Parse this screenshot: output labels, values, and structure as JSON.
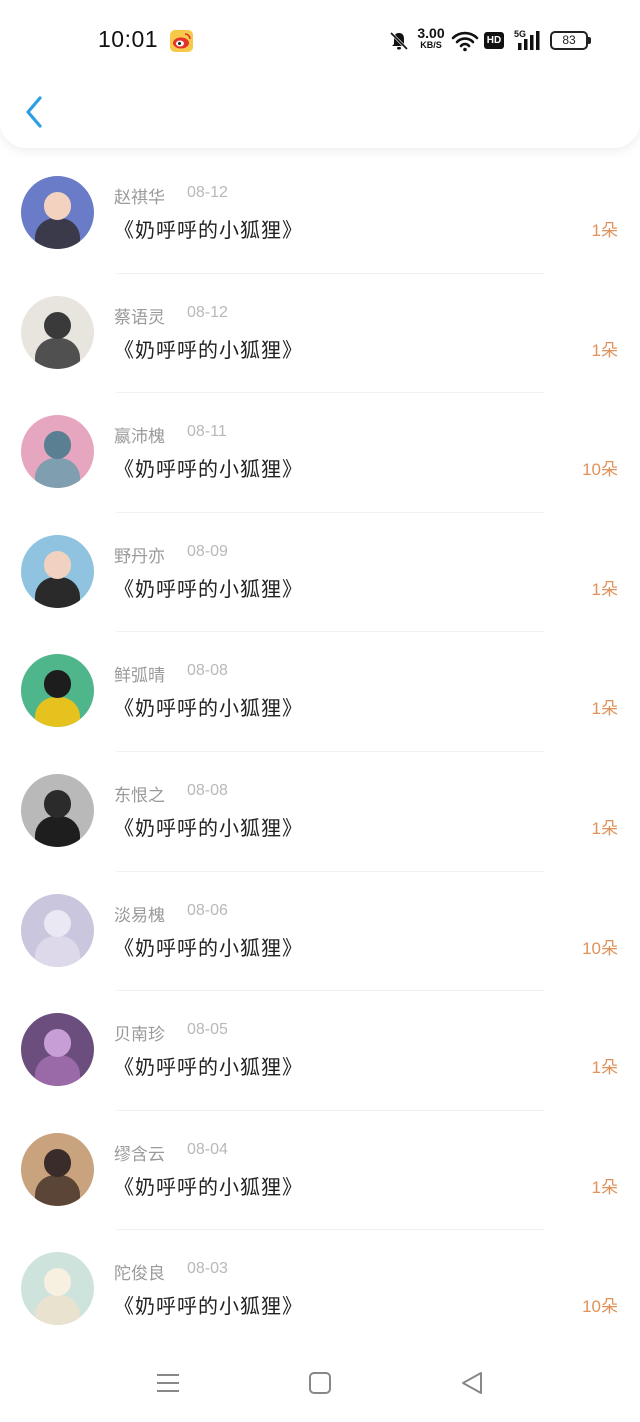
{
  "status_bar": {
    "time": "10:01",
    "net_speed_value": "3.00",
    "net_speed_unit": "KB/S",
    "hd_label": "HD",
    "cellular_label": "5G",
    "battery_level": "83",
    "icons": [
      "weibo-icon",
      "mute-bell-icon",
      "wifi-icon",
      "hd-icon",
      "signal-icon",
      "battery-icon"
    ]
  },
  "header": {
    "back_icon": "chevron-left-icon"
  },
  "colors": {
    "accent_blue": "#2b9fe6",
    "count_orange": "#e0925a",
    "name_gray": "#9a9a9a",
    "date_gray": "#b8b8b8"
  },
  "records": [
    {
      "name": "赵祺华",
      "date": "08-12",
      "gift": "《奶呼呼的小狐狸》",
      "count": "1朵",
      "avatar_bg": "#6a7cc7",
      "avatar_fg": "#f3d3bf",
      "avatar_body": "#3a3a4a"
    },
    {
      "name": "蔡语灵",
      "date": "08-12",
      "gift": "《奶呼呼的小狐狸》",
      "count": "1朵",
      "avatar_bg": "#e8e4de",
      "avatar_fg": "#3a3a3a",
      "avatar_body": "#505050"
    },
    {
      "name": "嬴沛槐",
      "date": "08-11",
      "gift": "《奶呼呼的小狐狸》",
      "count": "10朵",
      "avatar_bg": "#e6a6bf",
      "avatar_fg": "#5a7f93",
      "avatar_body": "#7f9fb0"
    },
    {
      "name": "野丹亦",
      "date": "08-09",
      "gift": "《奶呼呼的小狐狸》",
      "count": "1朵",
      "avatar_bg": "#8fc3e0",
      "avatar_fg": "#f1d2c0",
      "avatar_body": "#2a2a2a"
    },
    {
      "name": "鲜弧晴",
      "date": "08-08",
      "gift": "《奶呼呼的小狐狸》",
      "count": "1朵",
      "avatar_bg": "#4fb58a",
      "avatar_fg": "#1d1d1d",
      "avatar_body": "#e6c21e"
    },
    {
      "name": "东恨之",
      "date": "08-08",
      "gift": "《奶呼呼的小狐狸》",
      "count": "1朵",
      "avatar_bg": "#b9b9b9",
      "avatar_fg": "#2b2b2b",
      "avatar_body": "#1e1e1e"
    },
    {
      "name": "淡易槐",
      "date": "08-06",
      "gift": "《奶呼呼的小狐狸》",
      "count": "10朵",
      "avatar_bg": "#c9c6dd",
      "avatar_fg": "#eae8f2",
      "avatar_body": "#ddd9ea"
    },
    {
      "name": "贝南珍",
      "date": "08-05",
      "gift": "《奶呼呼的小狐狸》",
      "count": "1朵",
      "avatar_bg": "#6b4e7e",
      "avatar_fg": "#c79ed6",
      "avatar_body": "#9a6aa8"
    },
    {
      "name": "缪含云",
      "date": "08-04",
      "gift": "《奶呼呼的小狐狸》",
      "count": "1朵",
      "avatar_bg": "#c9a27e",
      "avatar_fg": "#3a2c2a",
      "avatar_body": "#5b4536"
    },
    {
      "name": "陀俊良",
      "date": "08-03",
      "gift": "《奶呼呼的小狐狸》",
      "count": "10朵",
      "avatar_bg": "#cfe3dd",
      "avatar_fg": "#f7efe0",
      "avatar_body": "#e9e2cf"
    }
  ],
  "nav_bar": {
    "icons": [
      "menu-icon",
      "home-square-icon",
      "back-triangle-icon"
    ]
  }
}
